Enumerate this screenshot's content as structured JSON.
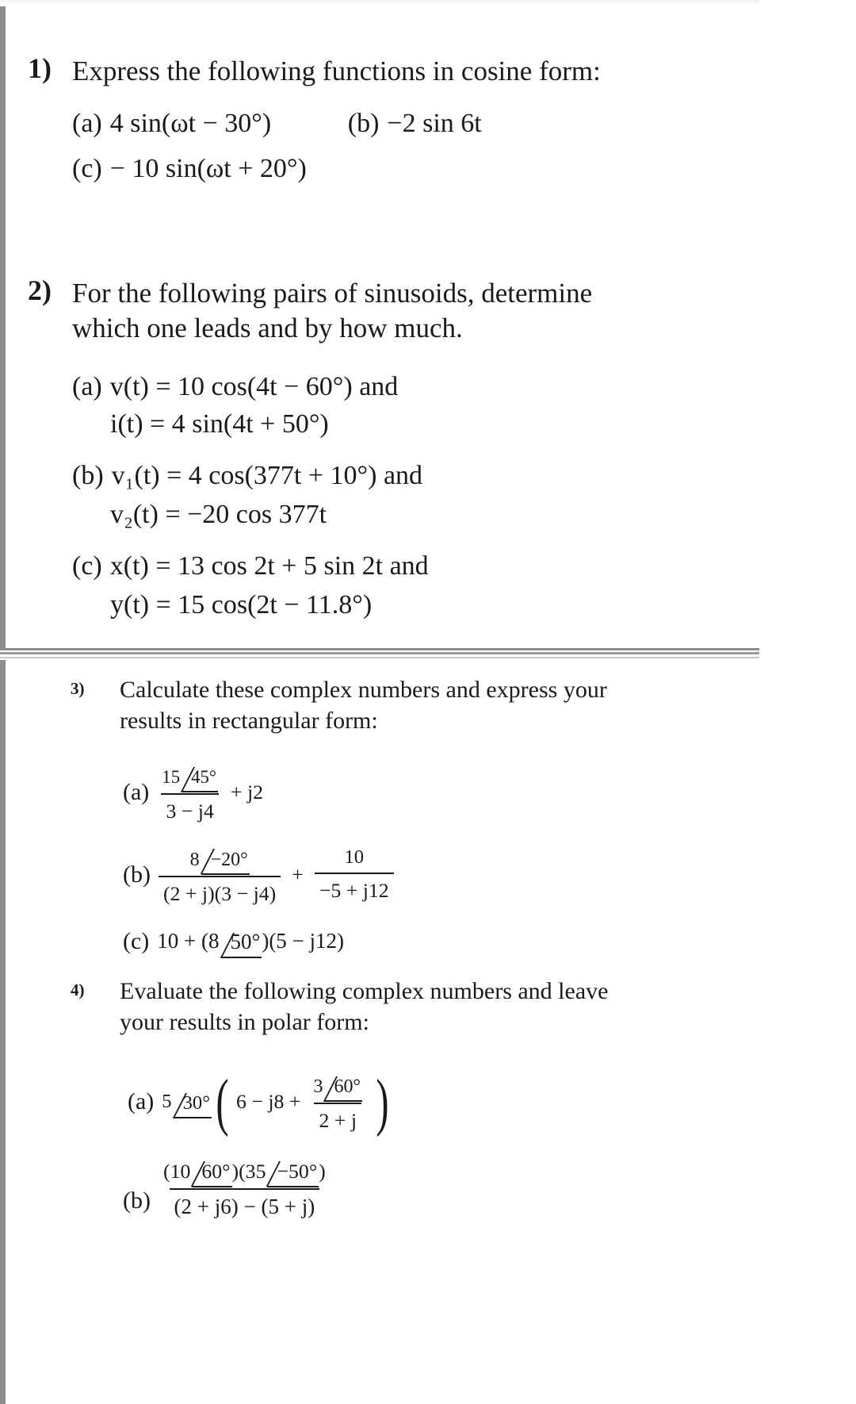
{
  "document": {
    "type": "homework-worksheet",
    "sections": [
      {
        "id": "upper",
        "problems": [
          {
            "number": "1)",
            "statement": "Express the following functions in cosine form:",
            "parts_row1": [
              {
                "label": "(a)",
                "expr": "4 sin(ωt − 30°)"
              },
              {
                "label": "(b)",
                "expr": "−2 sin 6t"
              }
            ],
            "parts_row2": [
              {
                "label": "(c)",
                "expr": "− 10 sin(ωt + 20°)"
              }
            ]
          },
          {
            "number": "2)",
            "statement_line1": "For the following pairs of sinusoids, determine",
            "statement_line2": "which one leads and by how much.",
            "parts": [
              {
                "label": "(a)",
                "line1": "v(t)  =  10 cos(4t − 60°) and",
                "line2": "i(t)  =  4 sin(4t + 50°)"
              },
              {
                "label": "(b)",
                "line1": "v₁(t)  =  4 cos(377t + 10°) and",
                "line2": "v₂(t)  =  −20 cos 377t"
              },
              {
                "label": "(c)",
                "line1": "x(t)  =  13 cos 2t + 5 sin 2t and",
                "line2": "y(t)  =  15 cos(2t − 11.8°)"
              }
            ]
          }
        ]
      },
      {
        "id": "lower",
        "problems": [
          {
            "number": "3)",
            "statement_line1": "Calculate these complex numbers and express your",
            "statement_line2": "results in rectangular form:",
            "parts": {
              "a": {
                "label": "(a)",
                "numerator_mag": "15",
                "numerator_angle": "45°",
                "denominator": "3 − j4",
                "tail": "+ j2"
              },
              "b": {
                "label": "(b)",
                "frac1_numerator_mag": "8",
                "frac1_numerator_angle": "−20°",
                "frac1_denominator": "(2 + j)(3 − j4)",
                "operator": "+",
                "frac2_numerator": "10",
                "frac2_denominator": "−5 + j12"
              },
              "c": {
                "label": "(c)",
                "prefix": "10 + (8",
                "angle": "50°",
                "suffix": ")(5 − j12)"
              }
            }
          },
          {
            "number": "4)",
            "statement_line1": "Evaluate the following complex numbers and leave",
            "statement_line2": "your results in polar form:",
            "parts": {
              "a": {
                "label": "(a)",
                "outer_mag": "5",
                "outer_angle": "30°",
                "inner_lead": "6 − j8 +",
                "inner_frac_numerator_mag": "3",
                "inner_frac_numerator_angle": "60°",
                "inner_frac_denominator": "2 + j"
              },
              "b": {
                "label": "(b)",
                "numerator_part1_mag": "(10",
                "numerator_part1_angle": "60°",
                "numerator_mid": ")(35",
                "numerator_part2_angle": "−50°",
                "numerator_end": ")",
                "denominator": "(2 + j6) − (5 + j)"
              }
            }
          }
        ]
      }
    ]
  },
  "colors": {
    "page_background": "#ffffff",
    "text": "#1a1a1a",
    "scan_border": "#8d8d8d",
    "divider": "#9a9a9a"
  }
}
